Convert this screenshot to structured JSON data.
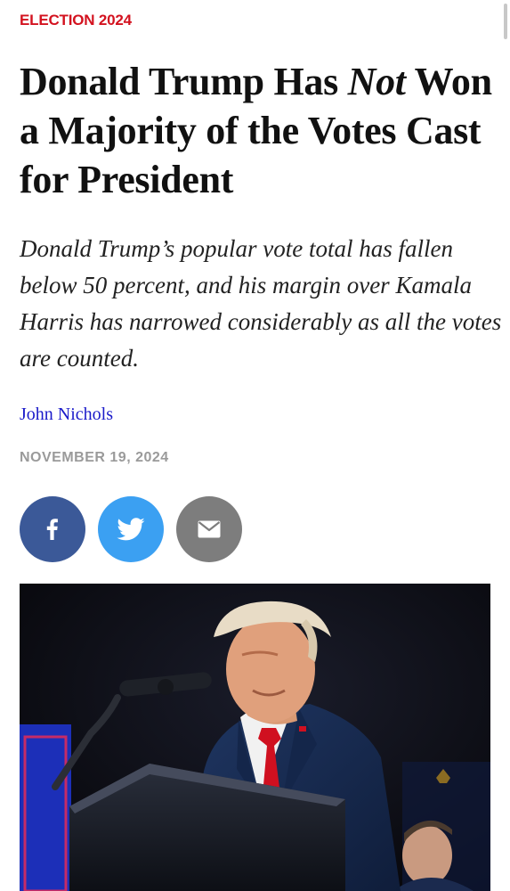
{
  "article": {
    "kicker": "ELECTION 2024",
    "headline_part1": "Donald Trump Has ",
    "headline_italic": "Not",
    "headline_part2": " Won a Majority of the Votes Cast for President",
    "dek": "Donald Trump’s popular vote total has fallen below 50 percent, and his margin over Kamala Harris has narrowed considerably as all the votes are counted.",
    "author": "John Nichols",
    "date": "NOVEMBER 19, 2024"
  },
  "share": {
    "facebook_icon": "facebook-icon",
    "twitter_icon": "twitter-icon",
    "email_icon": "email-icon"
  },
  "colors": {
    "kicker": "#d3121f",
    "byline": "#1a1ac9",
    "date": "#9a9a9a",
    "facebook": "#3b5998",
    "twitter": "#3ba0f2",
    "email": "#7d7d7d",
    "tie": "#d01020",
    "suit": "#16284a"
  }
}
